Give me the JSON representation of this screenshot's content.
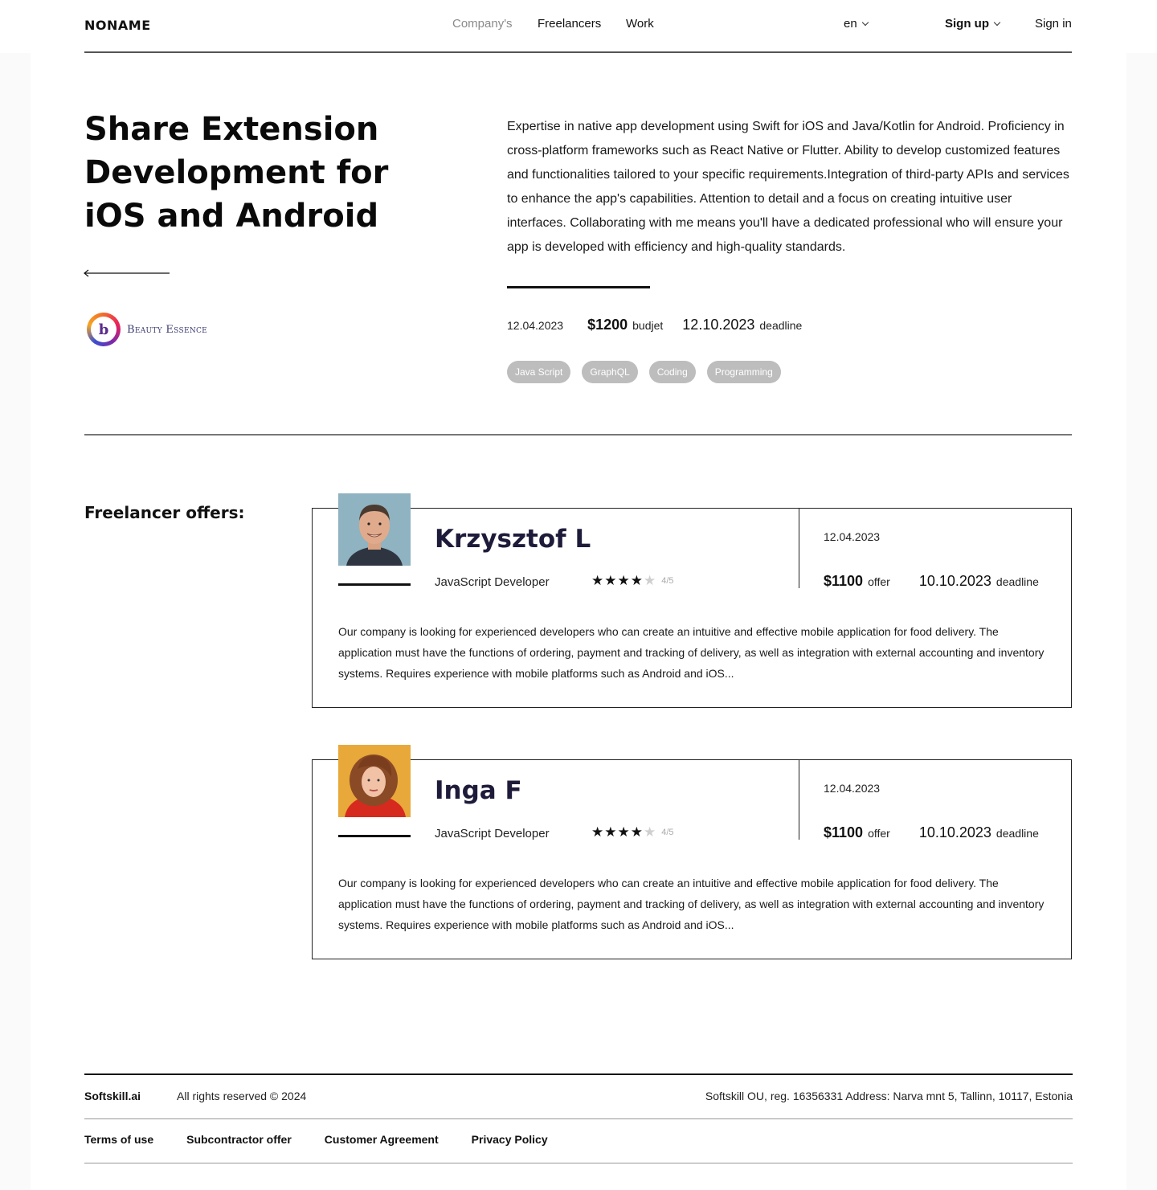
{
  "header": {
    "logo": "NONAME",
    "nav": [
      "Company's",
      "Freelancers",
      "Work"
    ],
    "language": "en",
    "signup": "Sign up",
    "signin": "Sign in"
  },
  "project": {
    "title": "Share Extension Development for iOS and Android",
    "description": "Expertise in native app development using Swift for iOS and Java/Kotlin for Android. Proficiency in cross-platform frameworks such as React Native or Flutter. Ability to develop customized features and functionalities tailored to your specific requirements.Integration of third-party APIs and services to enhance the app's capabilities. Attention to detail and a focus on creating intuitive user interfaces. Collaborating with me means you'll have a dedicated professional who will ensure your app is developed with efficiency and high-quality standards.",
    "client_name": "Beauty Essence",
    "client_logo_letter": "b",
    "date": "12.04.2023",
    "budget": "$1200",
    "budget_label": "budjet",
    "deadline": "12.10.2023",
    "deadline_label": "deadline",
    "tags": [
      "Java Script",
      "GraphQL",
      "Coding",
      "Programming"
    ]
  },
  "offers": {
    "heading": "Freelancer offers:",
    "items": [
      {
        "name": "Krzysztof L",
        "role": "JavaScript Developer",
        "rating": 4,
        "rating_max": 5,
        "rating_text": "4/5",
        "date": "12.04.2023",
        "offer": "$1100",
        "offer_label": "offer",
        "deadline": "10.10.2023",
        "deadline_label": "deadline",
        "text": "Our company is looking for experienced developers who can create an intuitive and effective mobile application for food delivery. The application must have the functions of ordering, payment and tracking of delivery, as well as integration with external accounting and inventory systems. Requires experience with mobile platforms such as Android and iOS..."
      },
      {
        "name": "Inga F",
        "role": "JavaScript Developer",
        "rating": 4,
        "rating_max": 5,
        "rating_text": "4/5",
        "date": "12.04.2023",
        "offer": "$1100",
        "offer_label": "offer",
        "deadline": "10.10.2023",
        "deadline_label": "deadline",
        "text": "Our company is looking for experienced developers who can create an intuitive and effective mobile application for food delivery. The application must have the functions of ordering, payment and tracking of delivery, as well as integration with external accounting and inventory systems. Requires experience with mobile platforms such as Android and iOS..."
      }
    ]
  },
  "footer": {
    "brand": "Softskill.ai",
    "rights": "All rights reserved © 2024",
    "address": "Softskill OU, reg. 16356331 Address: Narva mnt 5, Tallinn, 10117, Estonia",
    "links": [
      "Terms of use",
      "Subcontractor offer",
      "Customer Agreement",
      "Privacy Policy"
    ]
  },
  "colors": {
    "tag_bg": "#bdbdbd",
    "name_color": "#1e1b3a",
    "photo1_bg": "#8fb3c0",
    "photo2_bg": "#e8a83a"
  }
}
